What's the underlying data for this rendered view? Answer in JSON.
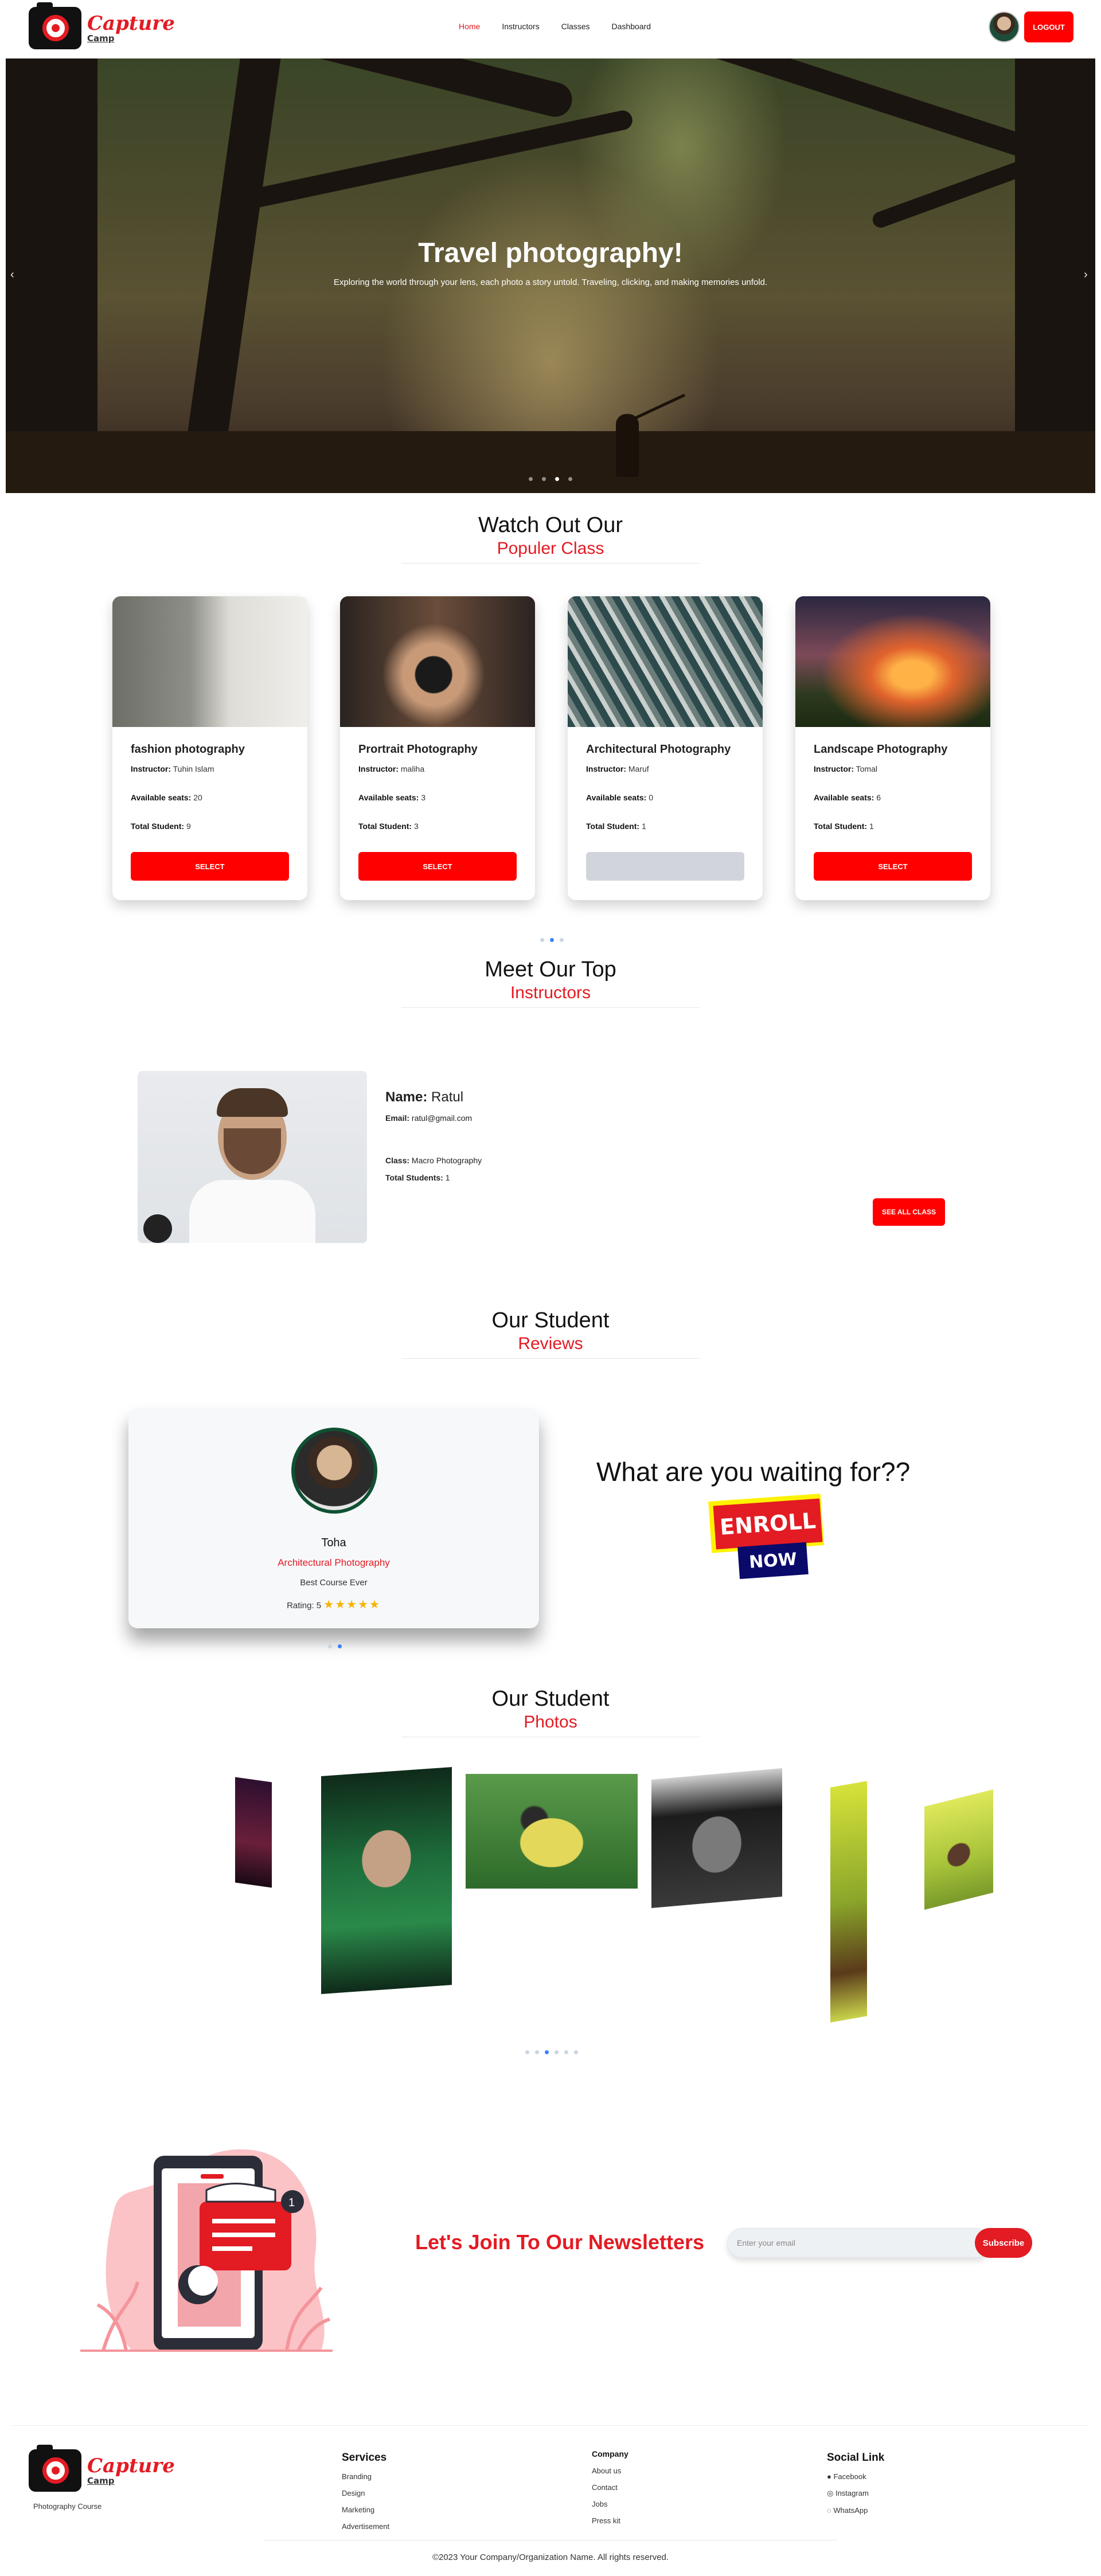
{
  "nav": {
    "logo_line1": "Capture",
    "logo_line2": "Camp",
    "links": [
      "Home",
      "Instructors",
      "Classes",
      "Dashboard"
    ],
    "logout": "LOGOUT"
  },
  "hero": {
    "title": "Travel photography!",
    "subtitle": "Exploring the world through your lens, each photo a story untold. Traveling, clicking, and making memories unfold.",
    "prev_icon": "‹",
    "next_icon": "›"
  },
  "popular": {
    "title": "Watch Out Our",
    "highlight": "Populer Class",
    "instructor_label": "Instructor:",
    "seats_label": "Available seats:",
    "students_label": "Total Student:",
    "select_label": "SELECT",
    "classes": [
      {
        "title": "fashion photography",
        "instructor": "Tuhin Islam",
        "seats": "20",
        "students": "9"
      },
      {
        "title": "Prortrait Photography",
        "instructor": "maliha",
        "seats": "3",
        "students": "3"
      },
      {
        "title": "Architectural Photography",
        "instructor": "Maruf",
        "seats": "0",
        "students": "1"
      },
      {
        "title": "Landscape Photography",
        "instructor": "Tomal",
        "seats": "6",
        "students": "1"
      }
    ]
  },
  "instructors": {
    "title": "Meet Our Top",
    "highlight": "Instructors",
    "name_label": "Name:",
    "name": "Ratul",
    "email_label": "Email:",
    "email": "ratul@gmail.com",
    "class_label": "Class:",
    "class": "Macro Photography",
    "students_label": "Total Students:",
    "students": "1",
    "see_all": "SEE ALL CLASS"
  },
  "reviews": {
    "title": "Our Student",
    "highlight": "Reviews",
    "name": "Toha",
    "class": "Architectural Photography",
    "text": "Best Course Ever",
    "rating_label": "Rating: 5",
    "stars": "★★★★★",
    "cta": "What are you waiting for??",
    "enroll_1": "ENROLL",
    "enroll_2": "NOW"
  },
  "photos": {
    "title": "Our Student",
    "highlight": "Photos"
  },
  "newsletter": {
    "title": "Let's Join To Our Newsletters",
    "placeholder": "Enter your email",
    "subscribe": "Subscribe"
  },
  "footer": {
    "tagline": "Photography Course",
    "services_title": "Services",
    "services": [
      "Branding",
      "Design",
      "Marketing",
      "Advertisement"
    ],
    "company_title": "Company",
    "company": [
      "About us",
      "Contact",
      "Jobs",
      "Press kit"
    ],
    "social_title": "Social Link",
    "social": [
      "Facebook",
      "Instagram",
      "WhatsApp"
    ],
    "copyright": "©2023 Your Company/Organization Name. All rights reserved."
  },
  "colors": {
    "accent": "#e31b23",
    "button": "#ff0000",
    "disabled": "#d1d5db",
    "dot_active": "#3b82f6"
  }
}
